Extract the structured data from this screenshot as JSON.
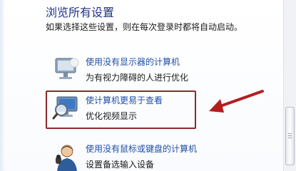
{
  "section": {
    "heading": "浏览所有设置",
    "description": "如果选择这些设置，则在每次登录时都将自动启动。"
  },
  "options": [
    {
      "link": "使用没有显示器的计算机",
      "subtitle": "为有视力障碍的人进行优化",
      "icon": "monitor-icon"
    },
    {
      "link": "使计算机更易于查看",
      "subtitle": "优化视频显示",
      "icon": "magnifier-monitor-icon"
    },
    {
      "link": "使用没有鼠标或键盘的计算机",
      "subtitle": "设置备选输入设备",
      "icon": "user-icon"
    }
  ],
  "colors": {
    "link": "#1f4ea8",
    "heading": "#1e3287",
    "highlight": "#8c2a2a",
    "arrow": "#b41e1e"
  }
}
